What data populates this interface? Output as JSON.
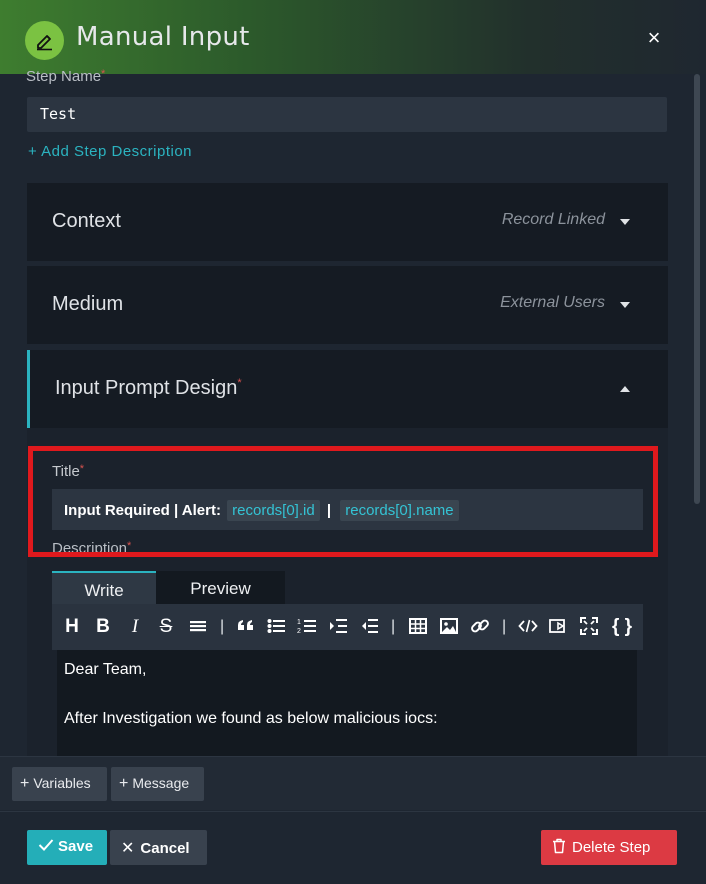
{
  "header": {
    "title": "Manual Input",
    "close_glyph": "×",
    "logo_icon": "pencil-icon"
  },
  "step_name": {
    "label": "Step Name",
    "required_mark": "*",
    "value": "Test"
  },
  "add_description": "+ Add Step Description",
  "panels": {
    "context": {
      "title": "Context",
      "value": "Record Linked"
    },
    "medium": {
      "title": "Medium",
      "value": "External Users"
    },
    "input_prompt": {
      "title": "Input Prompt Design",
      "required_mark": "*"
    }
  },
  "title_field": {
    "label": "Title",
    "required_mark": "*",
    "prefix": "Input Required | Alert:",
    "var1": "records[0].id",
    "separator": "|",
    "var2": "records[0].name"
  },
  "description_field": {
    "label": "Description",
    "required_mark": "*"
  },
  "editor": {
    "tabs": {
      "write": "Write",
      "preview": "Preview"
    },
    "toolbar": {
      "heading": "H",
      "bold": "B",
      "italic": "I",
      "strike": "S",
      "separator": "|",
      "braces": "{ }"
    },
    "content": {
      "line1": "Dear Team,",
      "line2": "After Investigation we found as below malicious iocs:"
    }
  },
  "insert_buttons": {
    "variables": "Variables",
    "message": "Message"
  },
  "footer": {
    "save": "Save",
    "cancel": "Cancel",
    "delete": "Delete Step"
  },
  "colors": {
    "accent": "#2bb3c0",
    "danger": "#dc3a43",
    "highlight": "#e0191d",
    "logo": "#7bc242"
  }
}
